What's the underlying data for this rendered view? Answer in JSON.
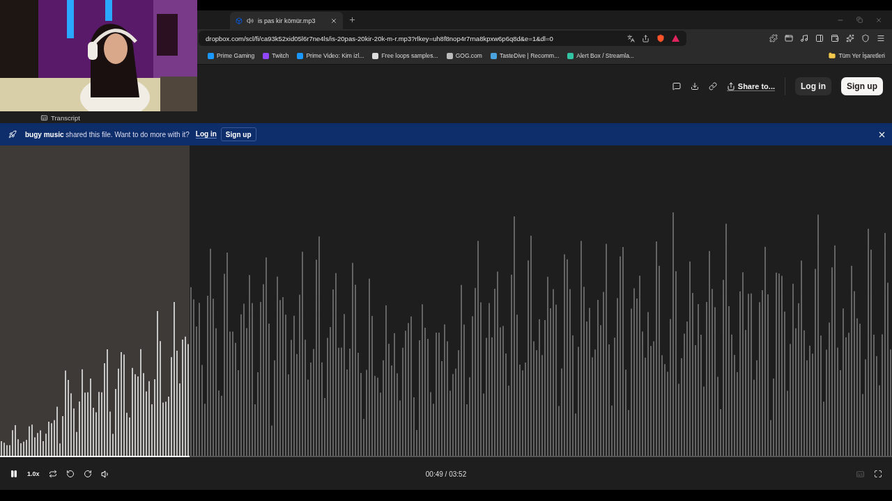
{
  "browser": {
    "tab": {
      "title": "is pas kir kömür.mp3",
      "selected": true
    },
    "url": "dropbox.com/scl/fi/ca93k52xid05l6r7ne4ls/is-20pas-20kir-20k-m-r.mp3?rlkey=uh8f8nop4r7rna8kpxw6p6q8d&e=1&dl=0",
    "bookmarks": [
      {
        "label": "Prime Gaming",
        "color": "#1a98ff"
      },
      {
        "label": "Twitch",
        "color": "#9146ff"
      },
      {
        "label": "Prime Video: Kim izl...",
        "color": "#1a98ff"
      },
      {
        "label": "Free loops samples...",
        "color": "#dddddd"
      },
      {
        "label": "GOG.com",
        "color": "#bbbbbb"
      },
      {
        "label": "TasteDive | Recomm...",
        "color": "#4aa3df"
      },
      {
        "label": "Alert Box / Streamla...",
        "color": "#31c3a2"
      }
    ],
    "all_bookmarks": "Tüm Yer İşaretleri"
  },
  "header": {
    "share": "Share to...",
    "login": "Log in",
    "signup": "Sign up"
  },
  "transcript": "Transcript",
  "banner": {
    "message": "**bugy music** shared this file. Want to do more with it?",
    "login": "Log in",
    "signup": "Sign up"
  },
  "player": {
    "level": 0.2125,
    "playing": true,
    "speed": "1.0x",
    "time": "00:49 / 03:52",
    "captions_disabled": true
  }
}
